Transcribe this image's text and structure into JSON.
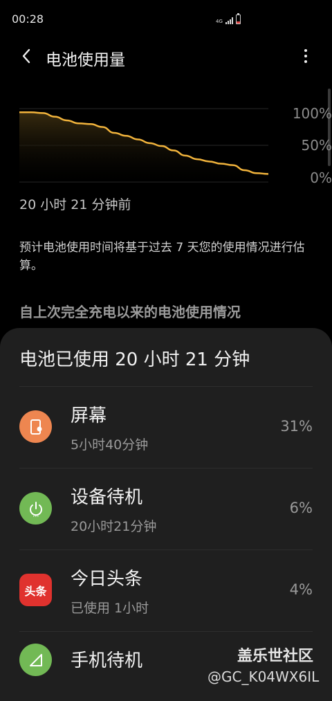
{
  "status_bar": {
    "time": "00:28",
    "network": "4G",
    "icons": [
      "signal-icon",
      "battery-low-icon"
    ]
  },
  "app_bar": {
    "back_icon": "chevron-left-icon",
    "title": "电池使用量",
    "more_icon": "more-vertical-icon"
  },
  "chart_data": {
    "type": "area",
    "y_ticks": [
      "100%",
      "50%",
      "0%"
    ],
    "ylim": [
      0,
      100
    ],
    "x_label": "20 小时 21 分钟前",
    "x": [
      0,
      1,
      2,
      3,
      4,
      5,
      6,
      7,
      8,
      9,
      10,
      11,
      12,
      13,
      14,
      15,
      16,
      17,
      18,
      19,
      20,
      21
    ],
    "values": [
      95,
      95,
      94,
      89,
      84,
      80,
      79,
      75,
      67,
      63,
      58,
      53,
      49,
      43,
      36,
      31,
      28,
      25,
      23,
      16,
      12,
      11
    ],
    "grid": true,
    "line_color": "#f2b43c",
    "fill_color": "#3a2d10"
  },
  "description": "预计电池使用时间将基于过去 7 天您的使用情况进行估算。",
  "section_title": "自上次完全充电以来的电池使用情况",
  "sheet": {
    "title": "电池已使用 20 小时 21 分钟",
    "items": [
      {
        "name": "屏幕",
        "detail": "5小时40分钟",
        "percent": "31%",
        "icon": "screen-brightness-icon",
        "color": "#ee8650"
      },
      {
        "name": "设备待机",
        "detail": "20小时21分钟",
        "percent": "6%",
        "icon": "power-standby-icon",
        "color": "#72b955"
      },
      {
        "name": "今日头条",
        "detail": "已使用 1小时",
        "percent": "4%",
        "icon": "toutiao-app-icon",
        "icon_text": "头条",
        "color": "#e0322e"
      },
      {
        "name": "手机待机",
        "detail": "",
        "percent": "",
        "icon": "cell-signal-icon",
        "color": "#72b955"
      }
    ]
  },
  "watermark": {
    "brand": "盖乐世社区",
    "user": "@GC_K04WX6IL"
  }
}
